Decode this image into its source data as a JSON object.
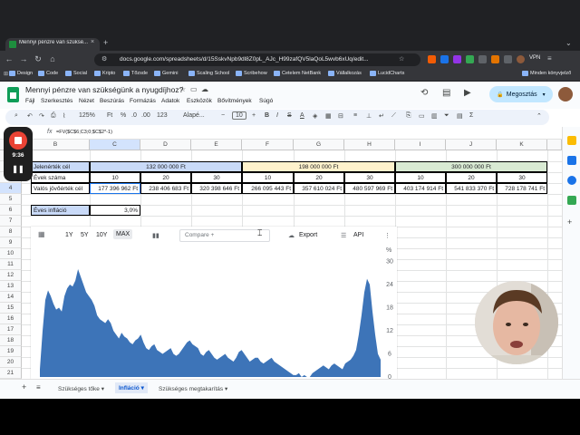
{
  "browser": {
    "tab_title": "Mennyi pénzre van szüksé...",
    "url": "docs.google.com/spreadsheets/d/15SskvNpb9dl8Z0pL_AJc_H99zafQV5laQoL5wvb6xUq/edit...",
    "vpn_label": "VPN",
    "bookmarks": [
      "Design",
      "Code",
      "Social",
      "Kripto",
      "Tőzsde",
      "Gemini",
      "Scaling School",
      "Scribehow",
      "Cetelem NetBank",
      "Vállalkozás",
      "LucidCharts"
    ],
    "other_bookmarks": "Minden könyvjelző"
  },
  "doc": {
    "title": "Mennyi pénzre van szükségünk a nyugdíjhoz?",
    "menus": [
      "Fájl",
      "Szerkesztés",
      "Nézet",
      "Beszúrás",
      "Formázás",
      "Adatok",
      "Eszközök",
      "Bővítmények",
      "Súgó"
    ],
    "share_label": "Megosztás"
  },
  "toolbar": {
    "zoom": "125%",
    "percent": "%",
    "dec1": ".0",
    "dec2": ".00",
    "numfmt": "123",
    "font": "Alapé...",
    "font_size": "10"
  },
  "formula_bar": {
    "fx": "fx",
    "formula": "=FV($C$6;C3;0;$C$2*-1)"
  },
  "columns": [
    "B",
    "C",
    "D",
    "E",
    "F",
    "G",
    "H",
    "I",
    "J",
    "K"
  ],
  "rows": [
    "1",
    "2",
    "3",
    "4",
    "5",
    "6",
    "7",
    "8",
    "9",
    "10",
    "11",
    "12",
    "13",
    "14",
    "15",
    "16",
    "17",
    "18",
    "19",
    "20",
    "21"
  ],
  "table": {
    "label_present": "Jelenérték cél",
    "label_years": "Évek száma",
    "label_future": "Valós jövőérték cél",
    "groups": [
      {
        "present": "132 000 000 Ft",
        "color": "#c9daf8",
        "years": [
          "10",
          "20",
          "30"
        ],
        "future": [
          "177 396 962 Ft",
          "238 406 683 Ft",
          "320 398 646 Ft"
        ]
      },
      {
        "present": "198 000 000 Ft",
        "color": "#fff2cc",
        "years": [
          "10",
          "20",
          "30"
        ],
        "future": [
          "266 095 443 Ft",
          "357 610 024 Ft",
          "480 597 969 Ft"
        ]
      },
      {
        "present": "300 000 000 Ft",
        "color": "#d9ead3",
        "years": [
          "10",
          "20",
          "30"
        ],
        "future": [
          "403 174 914 Ft",
          "541 833 370 Ft",
          "728 178 741 Ft"
        ]
      }
    ],
    "inflation_label": "Éves infláció",
    "inflation_value": "3,0%"
  },
  "chart_toolbar": {
    "ranges": [
      "1Y",
      "5Y",
      "10Y",
      "MAX"
    ],
    "compare_placeholder": "Compare +",
    "export_label": "Export",
    "api_label": "API"
  },
  "chart_data": {
    "type": "area",
    "unit_label": "%",
    "y_ticks": [
      "30",
      "24",
      "18",
      "12",
      "6",
      "0"
    ],
    "ylim": [
      0,
      32
    ],
    "series": [
      {
        "color": "#3d74b8",
        "values": [
          2.0,
          12.0,
          20.0,
          22.5,
          21.0,
          19.0,
          17.5,
          18.0,
          17.0,
          21.0,
          23.0,
          24.0,
          23.5,
          25.0,
          28.0,
          26.0,
          24.0,
          22.0,
          21.0,
          20.0,
          18.5,
          16.0,
          15.0,
          14.5,
          14.0,
          15.0,
          14.0,
          12.0,
          11.0,
          10.0,
          11.5,
          10.5,
          10.0,
          9.0,
          8.5,
          9.5,
          10.0,
          11.0,
          9.0,
          7.5,
          7.0,
          8.0,
          8.5,
          7.0,
          6.5,
          6.0,
          6.5,
          7.0,
          7.5,
          6.0,
          5.5,
          6.0,
          7.0,
          8.0,
          9.0,
          9.5,
          8.5,
          8.0,
          7.5,
          6.0,
          5.5,
          6.5,
          7.0,
          6.0,
          5.0,
          4.5,
          5.0,
          5.5,
          6.0,
          5.0,
          4.5,
          4.0,
          5.0,
          6.5,
          7.0,
          6.0,
          5.0,
          4.0,
          4.5,
          5.0,
          5.0,
          4.0,
          3.5,
          4.0,
          4.5,
          5.0,
          4.0,
          3.5,
          3.0,
          2.5,
          2.0,
          1.5,
          1.0,
          0.5,
          0.5,
          1.0,
          0.0,
          0.5,
          -0.5,
          0.0,
          1.0,
          1.5,
          2.0,
          2.5,
          3.0,
          2.5,
          2.0,
          3.0,
          3.5,
          3.0,
          2.5,
          2.0,
          3.5,
          4.0,
          4.5,
          5.5,
          7.0,
          11.0,
          16.0,
          22.0,
          25.5,
          24.0,
          17.0,
          11.0,
          6.0,
          4.5
        ]
      }
    ]
  },
  "sheet_tabs": [
    "Szükséges tőke",
    "Infláció",
    "Szükséges megtakarítás"
  ],
  "recorder": {
    "time": "9:36"
  },
  "colors": {
    "accent": "#0b57d0",
    "share_bg": "#c2e7ff",
    "sheets_green": "#0f9d58",
    "record_red": "#ea4335",
    "area_fill": "#3d74b8"
  }
}
